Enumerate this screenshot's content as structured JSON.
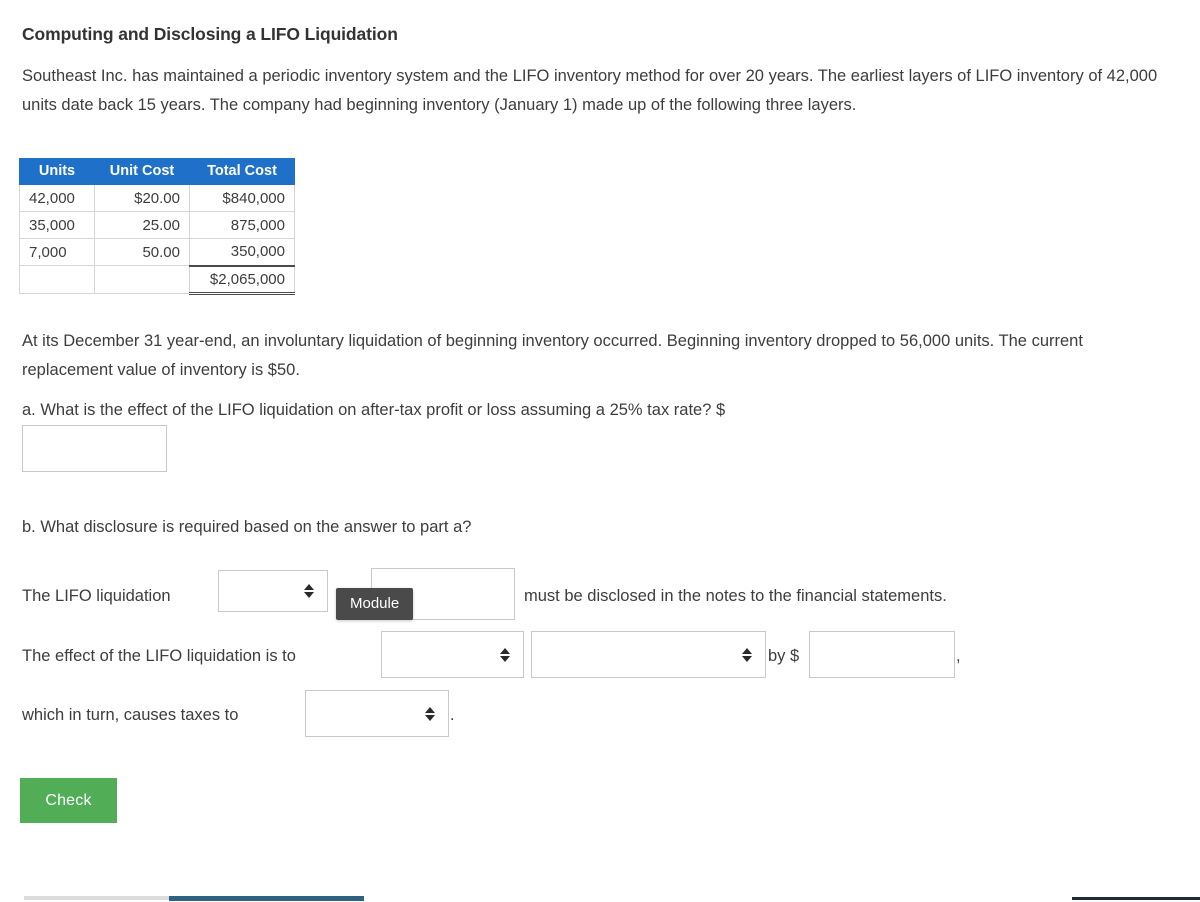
{
  "question": {
    "title": "Computing and Disclosing a LIFO Liquidation",
    "intro": "Southeast Inc. has maintained a periodic inventory system and the LIFO inventory method for over 20 years. The earliest layers of LIFO inventory of 42,000 units date back 15 years. The company had beginning inventory (January 1) made up of the following three layers.",
    "after_table": "At its December 31 year-end, an involuntary liquidation of beginning inventory occurred. Beginning inventory dropped to 56,000 units. The current replacement value of inventory is $50.",
    "part_a": "a. What is the effect of the LIFO liquidation on after-tax profit or loss assuming a 25% tax rate?  $",
    "part_b": "b. What disclosure is required based on the answer to part a?"
  },
  "table": {
    "headers": [
      "Units",
      "Unit Cost",
      "Total Cost"
    ],
    "rows": [
      {
        "units": "42,000",
        "unit_cost": "$20.00",
        "total_cost": "$840,000"
      },
      {
        "units": "35,000",
        "unit_cost": "25.00",
        "total_cost": "875,000"
      },
      {
        "units": "7,000",
        "unit_cost": "50.00",
        "total_cost": "350,000"
      }
    ],
    "total_row": {
      "units": "",
      "unit_cost": "",
      "total_cost": "$2,065,000"
    }
  },
  "answers": {
    "part_a_value": "",
    "row1": {
      "label_before": "The LIFO liquidation",
      "select_value": "",
      "text_value": "",
      "label_after": "must be disclosed in the notes to the financial statements."
    },
    "row2": {
      "label_before": "The effect of the LIFO liquidation is to",
      "select_a_value": "",
      "select_b_value": "",
      "label_middle": "by $",
      "text_value": "",
      "label_after": ","
    },
    "row3": {
      "label_before": "which in turn, causes taxes to",
      "select_value": "",
      "label_after": "."
    }
  },
  "tooltip": {
    "text": "Module"
  },
  "buttons": {
    "check_label": "Check"
  },
  "colors": {
    "table_header_blue": "#1f70c8",
    "check_green": "#51ae57",
    "tooltip_dark": "#4a4a4a",
    "bottom_accent_blue": "#2d6380"
  }
}
